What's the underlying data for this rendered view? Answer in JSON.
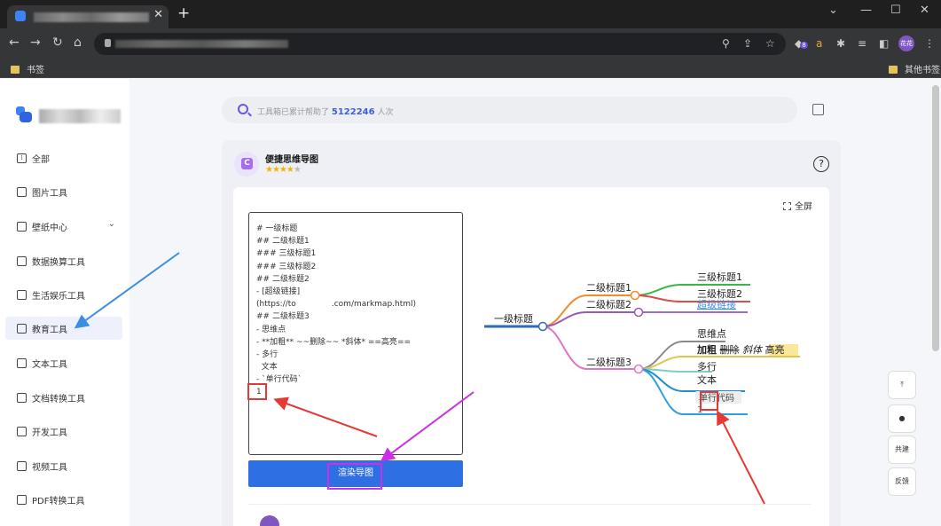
{
  "browser": {
    "bookmarks": [
      "书签",
      "其他书签"
    ],
    "extension_badge": "8",
    "profile": "花花"
  },
  "sidebar": {
    "items": [
      {
        "label": "全部",
        "icon": "grid-icon"
      },
      {
        "label": "图片工具",
        "icon": "image-icon"
      },
      {
        "label": "壁纸中心",
        "icon": "wallpaper-icon"
      },
      {
        "label": "数据换算工具",
        "icon": "chart-icon"
      },
      {
        "label": "生活娱乐工具",
        "icon": "entertainment-icon"
      },
      {
        "label": "教育工具",
        "icon": "education-icon"
      },
      {
        "label": "文本工具",
        "icon": "text-icon"
      },
      {
        "label": "文档转换工具",
        "icon": "document-icon"
      },
      {
        "label": "开发工具",
        "icon": "code-icon"
      },
      {
        "label": "视频工具",
        "icon": "video-icon"
      },
      {
        "label": "PDF转换工具",
        "icon": "pdf-icon"
      }
    ]
  },
  "search": {
    "prefix": "工具箱已累计帮助了",
    "count": "5122246",
    "suffix": "人次"
  },
  "tool": {
    "title": "便捷思维导图",
    "stars": "★★★★★",
    "help": "?",
    "fullscreen": "全屏",
    "render_button": "渲染导图"
  },
  "editor": {
    "lines": [
      "# 一级标题",
      "## 二级标题1",
      "### 三级标题1",
      "### 三级标题2",
      "## 二级标题2",
      "- [超级链接]",
      "(https://to              .com/markmap.html)",
      "## 二级标题3",
      "- 思维点",
      "- **加粗** ~~删除~~ *斜体* ==高亮==",
      "- 多行",
      "  文本",
      "- `单行代码`",
      "1"
    ]
  },
  "mindmap": {
    "root": "一级标题",
    "branch1": "二级标题1",
    "leaf1": "三级标题1",
    "leaf2": "三级标题2",
    "branch2": "二级标题2",
    "link": "超级链接",
    "branch3": "二级标题3",
    "point": "思维点",
    "bold": "加粗",
    "strike": "删除",
    "italic": "斜体",
    "highlight": "高亮",
    "multi1": "多行",
    "multi2": "文本",
    "code": "单行代码",
    "one": "1"
  },
  "right_tools": [
    "共建",
    "反馈"
  ],
  "colors": {
    "accent": "#2f6fe4",
    "annotation_red": "#e53935",
    "annotation_purple": "#cc30e6"
  }
}
